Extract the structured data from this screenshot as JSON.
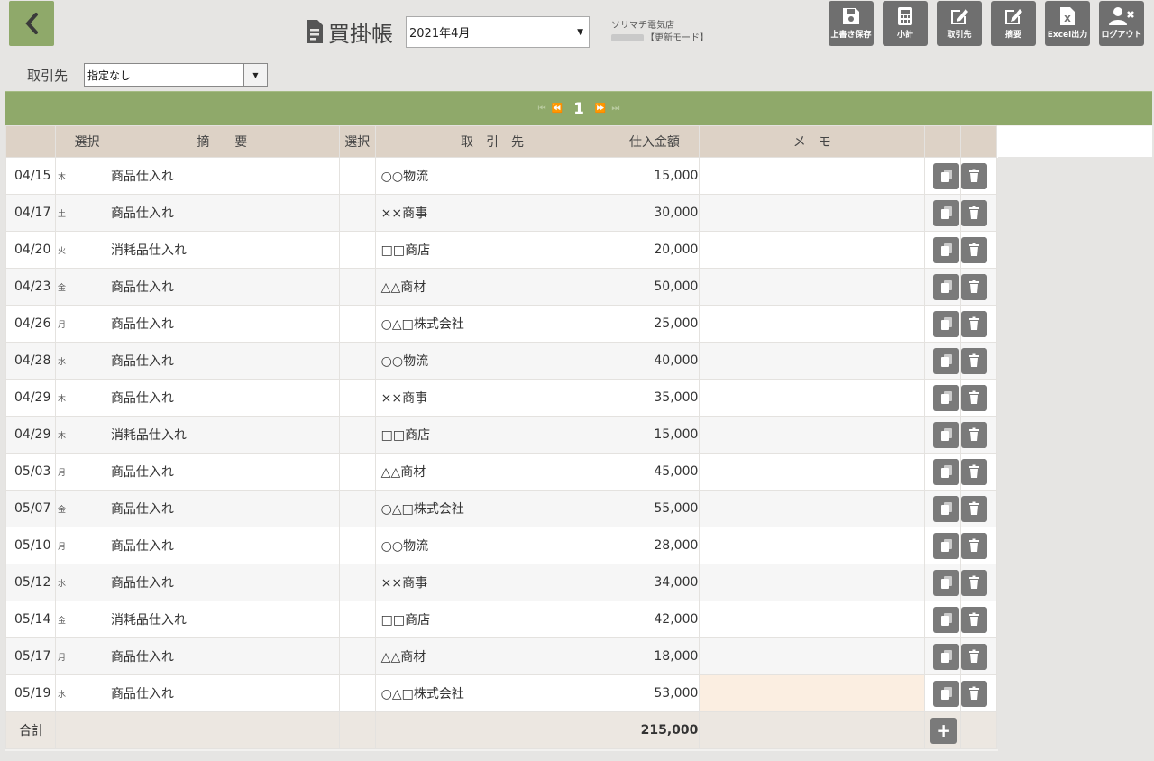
{
  "header": {
    "title": "買掛帳",
    "month": "2021年4月",
    "shop_name": "ソリマチ電気店",
    "mode": "【更新モード】"
  },
  "toolbar": [
    {
      "name": "save-button",
      "icon": "save-icon",
      "label": "上書き保存"
    },
    {
      "name": "subtotal-button",
      "icon": "calculator-icon",
      "label": "小計"
    },
    {
      "name": "vendor-button",
      "icon": "edit-icon",
      "label": "取引先"
    },
    {
      "name": "summary-button",
      "icon": "edit-icon",
      "label": "摘要"
    },
    {
      "name": "excel-button",
      "icon": "excel-icon",
      "label": "Excel出力"
    },
    {
      "name": "logout-button",
      "icon": "user-x-icon",
      "label": "ログアウト"
    }
  ],
  "filter": {
    "label": "取引先",
    "value": "指定なし"
  },
  "pager": {
    "current": "1"
  },
  "columns": {
    "select1": "選択",
    "description": "摘　　要",
    "select2": "選択",
    "vendor": "取　引　先",
    "amount": "仕入金額",
    "memo": "メ　モ"
  },
  "rows": [
    {
      "date": "04/15",
      "dow": "木",
      "desc": "商品仕入れ",
      "vendor": "○○物流",
      "amount": "15,000",
      "memo": ""
    },
    {
      "date": "04/17",
      "dow": "土",
      "desc": "商品仕入れ",
      "vendor": "××商事",
      "amount": "30,000",
      "memo": ""
    },
    {
      "date": "04/20",
      "dow": "火",
      "desc": "消耗品仕入れ",
      "vendor": "□□商店",
      "amount": "20,000",
      "memo": ""
    },
    {
      "date": "04/23",
      "dow": "金",
      "desc": "商品仕入れ",
      "vendor": "△△商材",
      "amount": "50,000",
      "memo": ""
    },
    {
      "date": "04/26",
      "dow": "月",
      "desc": "商品仕入れ",
      "vendor": "○△□株式会社",
      "amount": "25,000",
      "memo": ""
    },
    {
      "date": "04/28",
      "dow": "水",
      "desc": "商品仕入れ",
      "vendor": "○○物流",
      "amount": "40,000",
      "memo": ""
    },
    {
      "date": "04/29",
      "dow": "木",
      "desc": "商品仕入れ",
      "vendor": "××商事",
      "amount": "35,000",
      "memo": ""
    },
    {
      "date": "04/29",
      "dow": "木",
      "desc": "消耗品仕入れ",
      "vendor": "□□商店",
      "amount": "15,000",
      "memo": ""
    },
    {
      "date": "05/03",
      "dow": "月",
      "desc": "商品仕入れ",
      "vendor": "△△商材",
      "amount": "45,000",
      "memo": ""
    },
    {
      "date": "05/07",
      "dow": "金",
      "desc": "商品仕入れ",
      "vendor": "○△□株式会社",
      "amount": "55,000",
      "memo": ""
    },
    {
      "date": "05/10",
      "dow": "月",
      "desc": "商品仕入れ",
      "vendor": "○○物流",
      "amount": "28,000",
      "memo": ""
    },
    {
      "date": "05/12",
      "dow": "水",
      "desc": "商品仕入れ",
      "vendor": "××商事",
      "amount": "34,000",
      "memo": ""
    },
    {
      "date": "05/14",
      "dow": "金",
      "desc": "消耗品仕入れ",
      "vendor": "□□商店",
      "amount": "42,000",
      "memo": ""
    },
    {
      "date": "05/17",
      "dow": "月",
      "desc": "商品仕入れ",
      "vendor": "△△商材",
      "amount": "18,000",
      "memo": ""
    },
    {
      "date": "05/19",
      "dow": "水",
      "desc": "商品仕入れ",
      "vendor": "○△□株式会社",
      "amount": "53,000",
      "memo": "",
      "memo_highlight": true
    }
  ],
  "total": {
    "label": "合計",
    "amount": "215,000"
  },
  "colors": {
    "accent": "#8fa96a",
    "header_bg": "#ddd2c6",
    "button": "#6f6f6f",
    "memo_highlight": "#fbeee1"
  }
}
